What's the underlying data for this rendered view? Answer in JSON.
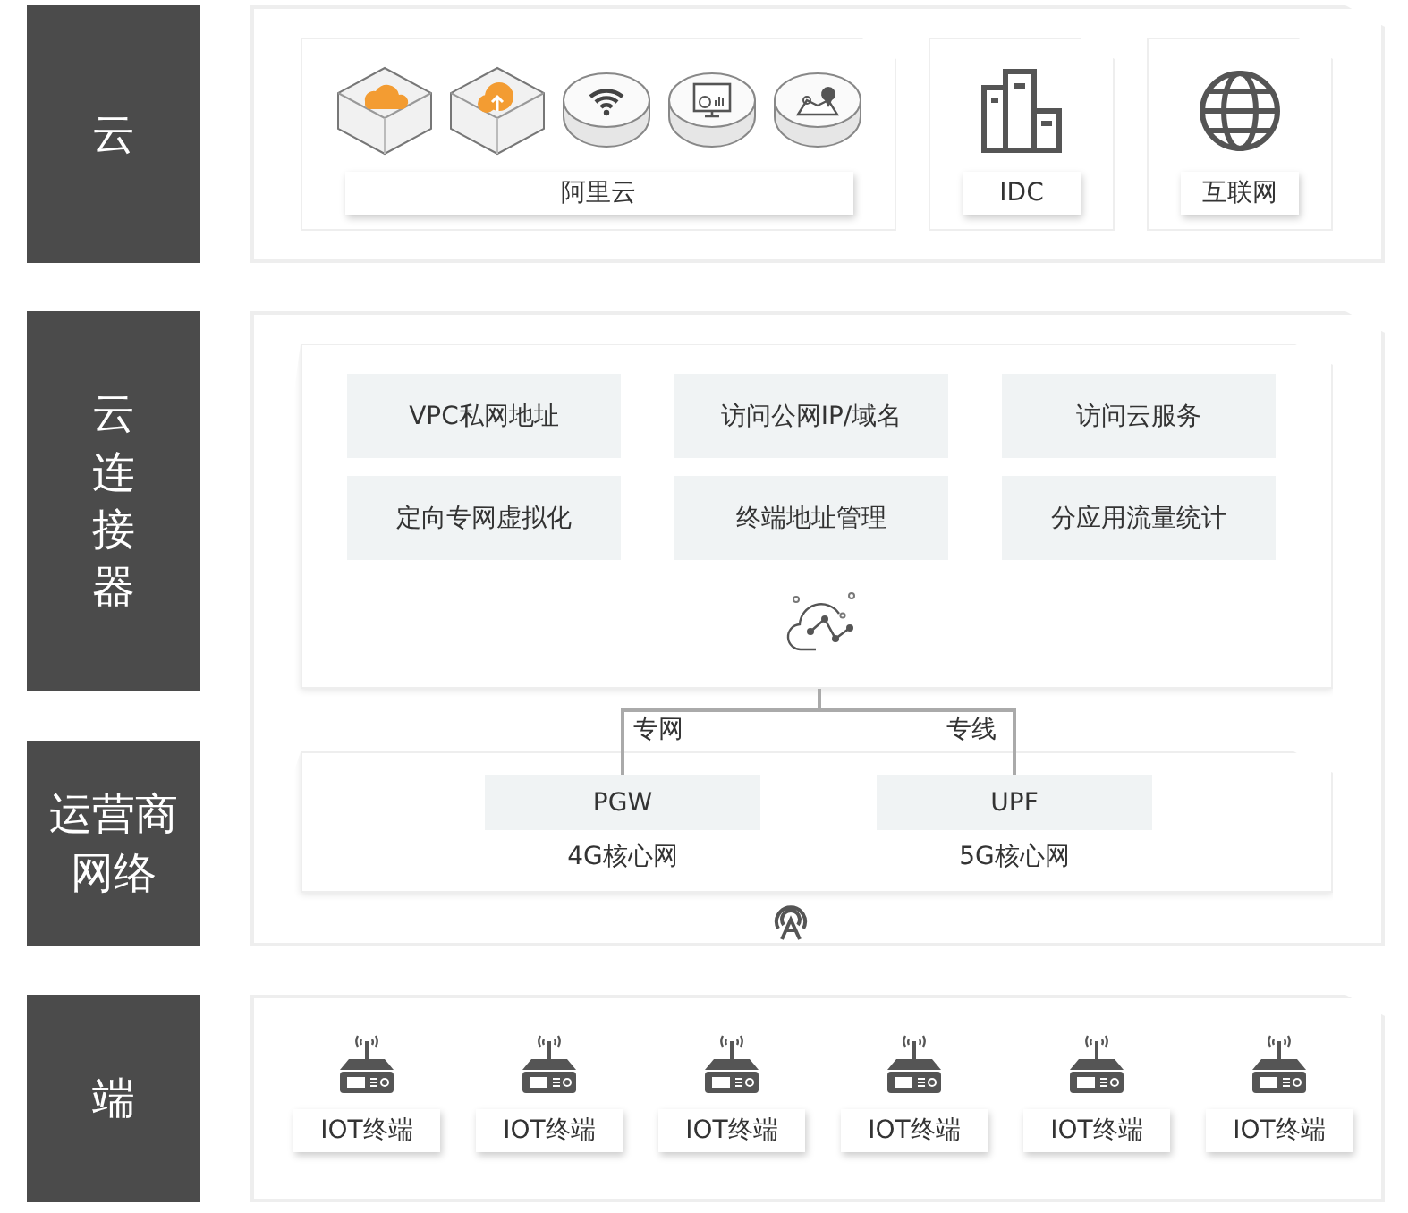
{
  "layers": [
    {
      "kind": "column",
      "label": "云"
    },
    {
      "kind": "column",
      "label": "云连接器"
    },
    {
      "kind": "block",
      "label": "运营商网络"
    },
    {
      "kind": "column",
      "label": "端"
    }
  ],
  "cloud": {
    "groups": [
      {
        "caption": "阿里云",
        "icons": [
          {
            "kind": "cloud"
          },
          {
            "kind": "upload"
          },
          {
            "kind": "wifi"
          },
          {
            "kind": "dashboard"
          },
          {
            "kind": "map"
          }
        ]
      },
      {
        "caption": "IDC",
        "icons": [
          {
            "kind": "building"
          }
        ]
      },
      {
        "caption": "互联网",
        "icons": [
          {
            "kind": "globe"
          }
        ]
      }
    ]
  },
  "connector": {
    "features": [
      "VPC私网地址",
      "访问公网IP/域名",
      "访问云服务",
      "定向专网虚拟化",
      "终端地址管理",
      "分应用流量统计"
    ]
  },
  "carrier": {
    "links": [
      {
        "label": "专网",
        "node": "PGW",
        "caption": "4G核心网"
      },
      {
        "label": "专线",
        "node": "UPF",
        "caption": "5G核心网"
      }
    ]
  },
  "devices": {
    "items": [
      "IOT终端",
      "IOT终端",
      "IOT终端",
      "IOT终端",
      "IOT终端",
      "IOT终端"
    ]
  }
}
